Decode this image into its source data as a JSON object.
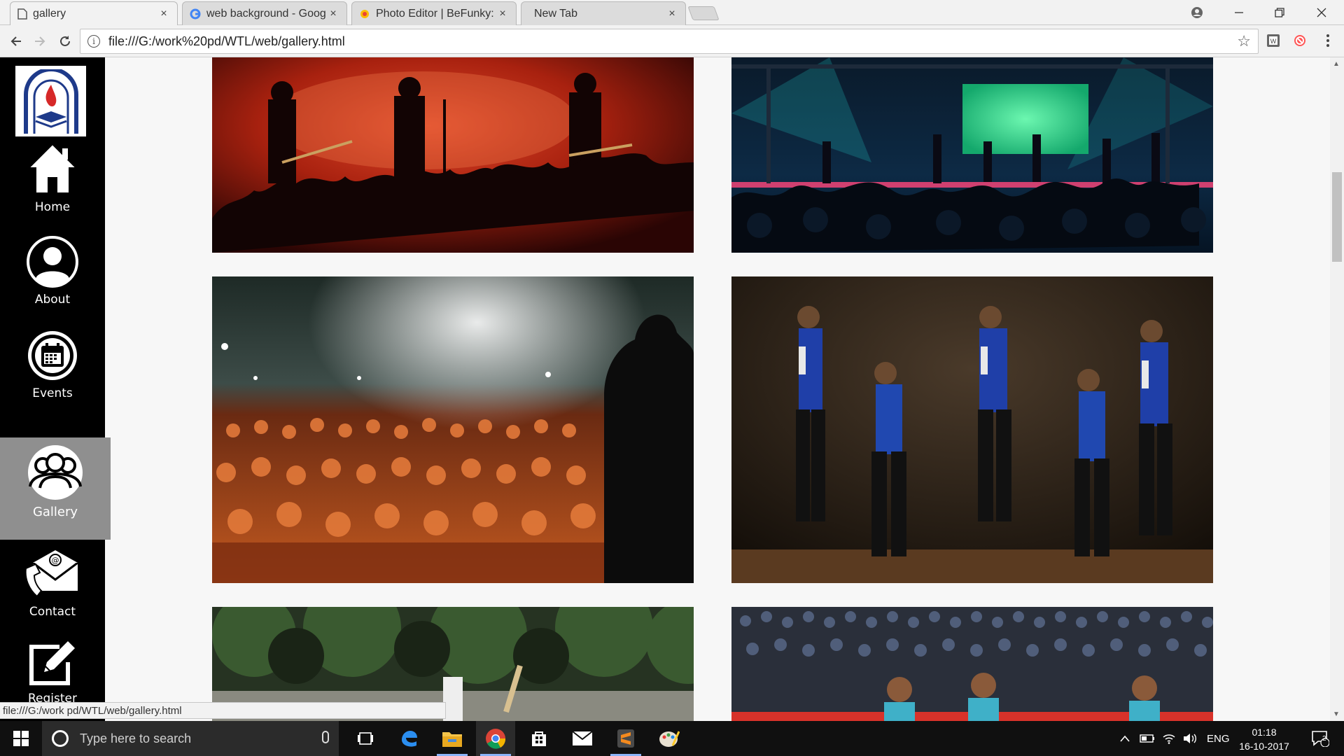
{
  "browser": {
    "tabs": [
      {
        "title": "gallery",
        "active": true
      },
      {
        "title": "web background - Goog",
        "active": false
      },
      {
        "title": "Photo Editor | BeFunky: F",
        "active": false
      },
      {
        "title": "New Tab",
        "active": false
      }
    ],
    "tab_close_glyph": "×",
    "url": "file:///G:/work%20pd/WTL/web/gallery.html",
    "status_url": "file:///G:/work pd/WTL/web/gallery.html"
  },
  "sidebar": {
    "items": [
      {
        "label": "Home",
        "icon": "home-icon"
      },
      {
        "label": "About",
        "icon": "user-icon"
      },
      {
        "label": "Events",
        "icon": "calendar-icon"
      },
      {
        "label": "Gallery",
        "icon": "group-icon",
        "active": true
      },
      {
        "label": "Contact",
        "icon": "mail-phone-icon"
      },
      {
        "label": "Register",
        "icon": "edit-icon"
      }
    ]
  },
  "gallery": {
    "photos": [
      {
        "subject": "rock band on red smoky stage"
      },
      {
        "subject": "concert stage with green lights"
      },
      {
        "subject": "performer facing cheering crowd"
      },
      {
        "subject": "dance crew in blue jackets"
      },
      {
        "subject": "cricket batsman under trees"
      },
      {
        "subject": "kabaddi team with stadium crowd"
      }
    ]
  },
  "taskbar": {
    "search_placeholder": "Type here to search",
    "language": "ENG",
    "time": "01:18",
    "date": "16-10-2017",
    "notification_count": "2"
  },
  "colors": {
    "sidebar_bg": "#000000",
    "sidebar_active": "#8f8f8f",
    "page_bg": "#f7f7f7",
    "taskbar_bg": "#101010"
  }
}
